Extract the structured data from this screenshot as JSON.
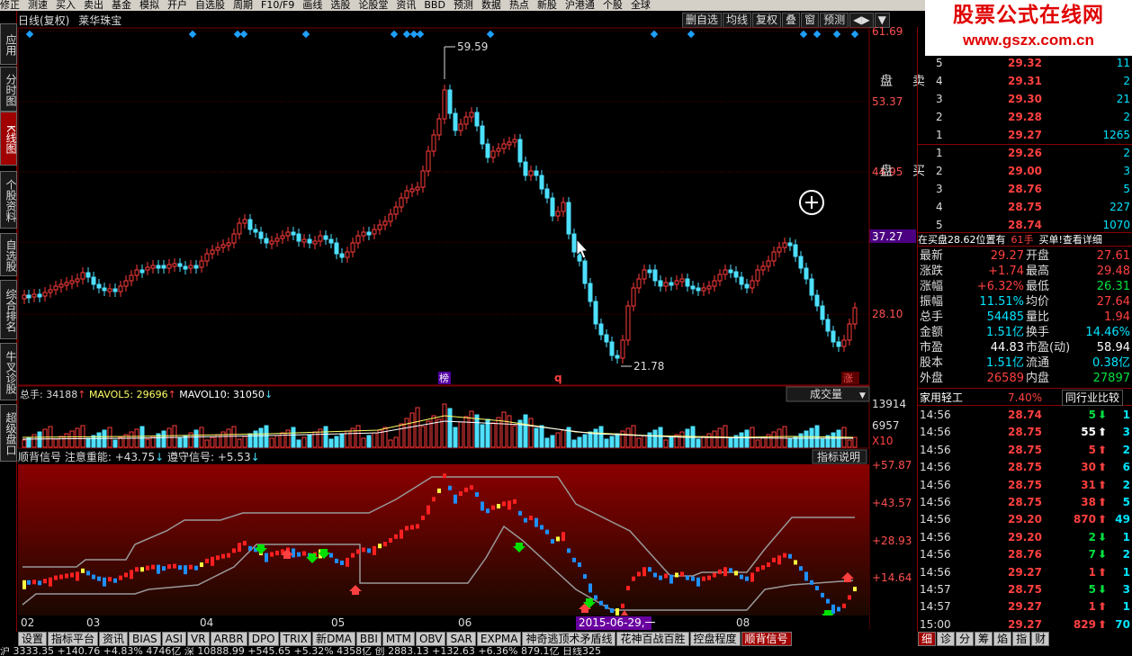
{
  "topbar": {
    "items": [
      "修正",
      "测速",
      "买入",
      "卖出",
      "基金",
      "模拟",
      "开户",
      "自选股",
      "周期",
      "F10/F9",
      "画线",
      "选股",
      "论股堂",
      "资讯",
      "BBD",
      "预测",
      "数据",
      "热点",
      "新股",
      "沪港通",
      "个股",
      "全球"
    ]
  },
  "watermark": {
    "title": "股票公式在线网",
    "url": "www.gszx.com.cn"
  },
  "left_tabs": [
    "应用",
    "分时图",
    "K线图",
    "个股资料",
    "自选股",
    "综合排名",
    "牛叉诊股",
    "超级盘口"
  ],
  "chart_header": {
    "period": "日线(复权)",
    "name": "莱华珠宝"
  },
  "chart_buttons": [
    "删自选",
    "均线",
    "复权",
    "叠",
    "窗",
    "预测",
    "◀▶",
    "▼"
  ],
  "price_axis": [
    "61.69",
    "53.37",
    "44.95",
    "37.27",
    "28.10"
  ],
  "price_marks": {
    "high": "59.59",
    "low": "21.78",
    "tag1": "榜",
    "tag2": "q",
    "tag3": "涨"
  },
  "volume_header": {
    "label": "总手:",
    "value": "34188",
    "mavol5_label": "MAVOL5:",
    "mavol5": "29696",
    "mavol10_label": "MAVOL10:",
    "mavol10": "31050",
    "right_label": "成交量"
  },
  "volume_axis": [
    "13914",
    "6957",
    "X10"
  ],
  "indicator_header": {
    "name": "顺背信号",
    "s1_label": "注意重能:",
    "s1": "+43.75",
    "s2_label": "遵守信号:",
    "s2": "+5.53",
    "right_label": "指标说明"
  },
  "indicator_axis": [
    "+57.87",
    "+43.57",
    "+28.93",
    "+14.64"
  ],
  "date_axis": [
    "02",
    "03",
    "04",
    "05",
    "06",
    "08"
  ],
  "date_cursor": "2015-06-29,一",
  "bottom_tabs": [
    "设置",
    "指标平台",
    "资讯",
    "BIAS",
    "ASI",
    "VR",
    "ARBR",
    "DPO",
    "TRIX",
    "新DMA",
    "BBI",
    "MTM",
    "OBV",
    "SAR",
    "EXPMA",
    "神奇逃顶术矛盾线",
    "花神百战百胜",
    "控盘程度",
    "顺背信号"
  ],
  "right_bottom_tabs": [
    "细",
    "诊",
    "分",
    "筹",
    "焰",
    "指",
    "财"
  ],
  "orderbook": {
    "sell_label": "卖盘",
    "buy_label": "买盘",
    "sell": [
      {
        "level": "5",
        "price": "29.32",
        "vol": "11"
      },
      {
        "level": "4",
        "price": "29.31",
        "vol": "2"
      },
      {
        "level": "3",
        "price": "29.30",
        "vol": "21"
      },
      {
        "level": "2",
        "price": "29.28",
        "vol": "2"
      },
      {
        "level": "1",
        "price": "29.27",
        "vol": "1265"
      }
    ],
    "buy": [
      {
        "level": "1",
        "price": "29.26",
        "vol": "2"
      },
      {
        "level": "2",
        "price": "29.00",
        "vol": "3"
      },
      {
        "level": "3",
        "price": "28.76",
        "vol": "5"
      },
      {
        "level": "4",
        "price": "28.75",
        "vol": "227"
      },
      {
        "level": "5",
        "price": "28.74",
        "vol": "1070"
      }
    ],
    "notice_a": "在买盘28.62位置有",
    "notice_b": "61手",
    "notice_c": "买单!",
    "notice_link": "查看详细"
  },
  "stats": [
    {
      "k1": "最新",
      "v1": "29.27",
      "k2": "开盘",
      "v2": "27.61"
    },
    {
      "k1": "涨跌",
      "v1": "+1.74",
      "k2": "最高",
      "v2": "29.48"
    },
    {
      "k1": "涨幅",
      "v1": "+6.32%",
      "k2": "最低",
      "v2": "26.31"
    },
    {
      "k1": "振幅",
      "v1": "11.51%",
      "k2": "均价",
      "v2": "27.64"
    },
    {
      "k1": "总手",
      "v1": "54485",
      "k2": "量比",
      "v2": "1.94"
    },
    {
      "k1": "金额",
      "v1": "1.51亿",
      "k2": "换手",
      "v2": "14.46%"
    },
    {
      "k1": "市盈",
      "v1": "44.83",
      "k2": "市盈(动)",
      "v2": "58.94"
    },
    {
      "k1": "股本",
      "v1": "1.51亿",
      "k2": "流通",
      "v2": "0.38亿"
    },
    {
      "k1": "外盘",
      "v1": "26589",
      "k2": "内盘",
      "v2": "27897"
    }
  ],
  "industry": {
    "name": "家用轻工",
    "change": "7.40%",
    "button": "同行业比较"
  },
  "ticks": [
    {
      "time": "14:56",
      "price": "28.74",
      "vol": "5",
      "dir": "down",
      "n": "1"
    },
    {
      "time": "14:56",
      "price": "28.75",
      "vol": "55",
      "dir": "up-white",
      "n": "3"
    },
    {
      "time": "14:56",
      "price": "28.75",
      "vol": "5",
      "dir": "up",
      "n": "2"
    },
    {
      "time": "14:56",
      "price": "28.75",
      "vol": "30",
      "dir": "up",
      "n": "6"
    },
    {
      "time": "14:56",
      "price": "28.75",
      "vol": "31",
      "dir": "up",
      "n": "2"
    },
    {
      "time": "14:56",
      "price": "28.75",
      "vol": "38",
      "dir": "up",
      "n": "5"
    },
    {
      "time": "14:56",
      "price": "29.20",
      "vol": "870",
      "dir": "up",
      "n": "49"
    },
    {
      "time": "14:56",
      "price": "29.20",
      "vol": "2",
      "dir": "down",
      "n": "1"
    },
    {
      "time": "14:56",
      "price": "28.76",
      "vol": "7",
      "dir": "down",
      "n": "2"
    },
    {
      "time": "14:56",
      "price": "29.27",
      "vol": "1",
      "dir": "up",
      "n": "1"
    },
    {
      "time": "14:57",
      "price": "28.75",
      "vol": "5",
      "dir": "down",
      "n": "3"
    },
    {
      "time": "14:57",
      "price": "29.27",
      "vol": "1",
      "dir": "up",
      "n": "1"
    },
    {
      "time": "15:00",
      "price": "29.27",
      "vol": "829",
      "dir": "up",
      "n": "70"
    }
  ],
  "status": "沪 3333.35 +140.76 +4.83% 4746亿 深 10888.99 +545.65 +5.32% 4358亿 创 2883.13 +132.63 +6.36% 879.1亿 日线325"
}
